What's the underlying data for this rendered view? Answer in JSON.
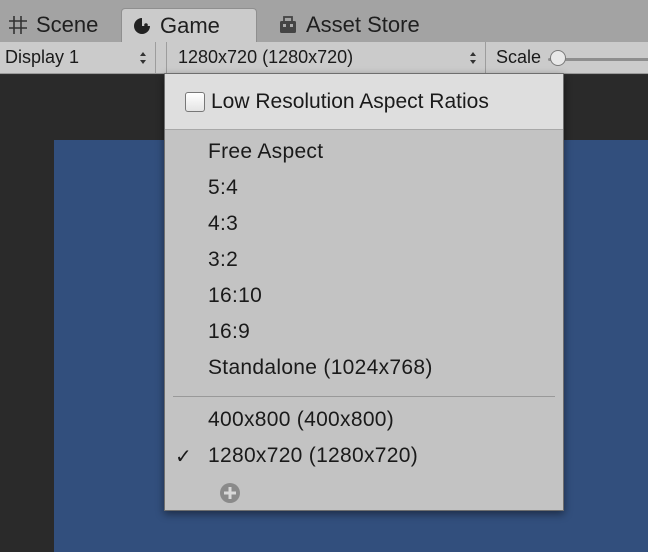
{
  "tabs": [
    {
      "label": "Scene",
      "icon": "grid-icon"
    },
    {
      "label": "Game",
      "icon": "pacman-icon"
    },
    {
      "label": "Asset Store",
      "icon": "store-bag-icon"
    }
  ],
  "toolbar": {
    "display_label": "Display 1",
    "resolution_label": "1280x720 (1280x720)",
    "scale_label": "Scale"
  },
  "menu": {
    "header_label": "Low Resolution Aspect Ratios",
    "builtin_items": [
      "Free Aspect",
      "5:4",
      "4:3",
      "3:2",
      "16:10",
      "16:9",
      "Standalone (1024x768)"
    ],
    "custom_items": [
      {
        "label": "400x800 (400x800)",
        "checked": false
      },
      {
        "label": "1280x720 (1280x720)",
        "checked": true
      }
    ],
    "check_glyph": "✓",
    "add_icon": "plus-circle-icon"
  },
  "colors": {
    "canvas_blue": "#324f7d",
    "menu_bg": "#c3c3c3",
    "tabbar_bg": "#a3a3a3"
  }
}
